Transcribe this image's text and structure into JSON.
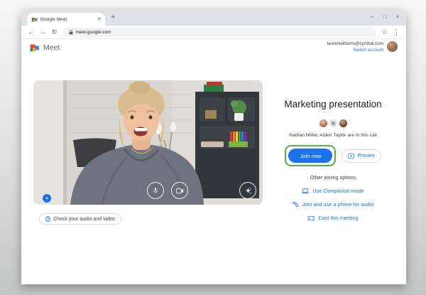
{
  "browser": {
    "tab_title": "Google Meet",
    "url": "meet.google.com"
  },
  "icons": {
    "close": "×",
    "plus": "+",
    "minimize": "–",
    "maximize": "□",
    "back": "←",
    "forward": "→",
    "reload": "↻",
    "star": "☆",
    "menu": "⋮",
    "more_vertical": "⋮",
    "sparkle": "✦"
  },
  "header": {
    "app_name": "Meet",
    "account_email": "laurenwilliams@cymbal.com",
    "switch_account_label": "Switch account"
  },
  "video_preview": {
    "check_label": "Check your audio and video"
  },
  "meeting": {
    "title": "Marketing presentation",
    "participants_text": "Nathan Miller, Aiden Taylor are in this call",
    "join_label": "Join now",
    "present_label": "Present",
    "other_options_title": "Other joining options",
    "options": [
      {
        "label": "Use Companion mode",
        "icon": "companion-mode-icon"
      },
      {
        "label": "Join and use a phone for audio",
        "icon": "phone-audio-icon"
      },
      {
        "label": "Cast this meeting",
        "icon": "cast-icon"
      }
    ]
  },
  "colors": {
    "accent_blue": "#1a73e8",
    "annotation_green": "#4db152",
    "text_dark": "#202124",
    "text_gray": "#5f6368"
  }
}
